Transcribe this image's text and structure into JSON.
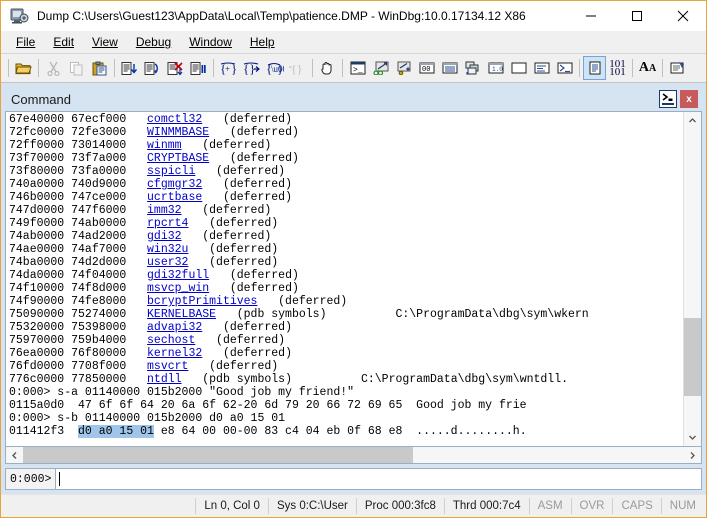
{
  "window": {
    "title": "Dump C:\\Users\\Guest123\\AppData\\Local\\Temp\\patience.DMP - WinDbg:10.0.17134.12 X86",
    "icon": "debugger-icon",
    "minimize_label": "–",
    "maximize_label": "☐",
    "close_label": "✕"
  },
  "menubar": {
    "items": [
      {
        "label": "File",
        "accel": "F"
      },
      {
        "label": "Edit",
        "accel": "E"
      },
      {
        "label": "View",
        "accel": "V"
      },
      {
        "label": "Debug",
        "accel": "D"
      },
      {
        "label": "Window",
        "accel": "W"
      },
      {
        "label": "Help",
        "accel": "H"
      }
    ]
  },
  "toolbar": {
    "groups": [
      {
        "buttons": [
          {
            "name": "open-folder-icon",
            "glyph": "📂",
            "disabled": false
          }
        ]
      },
      {
        "buttons": [
          {
            "name": "cut-icon",
            "glyph": "✂",
            "disabled": true
          },
          {
            "name": "copy-icon",
            "glyph": "⧉",
            "disabled": true
          },
          {
            "name": "paste-icon",
            "glyph": "📋",
            "disabled": false
          }
        ]
      },
      {
        "buttons": [
          {
            "name": "step-into-icon",
            "glyph": "↓",
            "disabled": false
          },
          {
            "name": "step-over-icon",
            "glyph": "↷",
            "disabled": false
          },
          {
            "name": "run-to-cursor-icon",
            "glyph": "✘",
            "disabled": false
          },
          {
            "name": "break-icon",
            "glyph": "‖",
            "disabled": false
          }
        ]
      },
      {
        "buttons": [
          {
            "name": "trace-into-icon",
            "glyph": "{+}",
            "disabled": false
          },
          {
            "name": "step-out-icon",
            "glyph": "{}→",
            "disabled": false
          },
          {
            "name": "step-branch-icon",
            "glyph": "{?}",
            "disabled": false
          },
          {
            "name": "trace-disabled-icon",
            "glyph": "{}",
            "disabled": true
          }
        ]
      },
      {
        "buttons": [
          {
            "name": "stop-debugging-hand-icon",
            "glyph": "✋",
            "disabled": false
          }
        ]
      },
      {
        "buttons": [
          {
            "name": "command-window-icon",
            "glyph": "▣",
            "disabled": false
          },
          {
            "name": "watch-window-icon",
            "glyph": "⚭",
            "disabled": false
          },
          {
            "name": "locals-window-icon",
            "glyph": "❖",
            "disabled": false
          },
          {
            "name": "registers-window-icon",
            "glyph": "▭",
            "disabled": false
          },
          {
            "name": "memory-window-icon",
            "glyph": "☰",
            "disabled": false
          },
          {
            "name": "call-stack-window-icon",
            "glyph": "❑",
            "disabled": false
          },
          {
            "name": "disassembly-window-icon",
            "glyph": "▤",
            "disabled": false
          },
          {
            "name": "scratch-pad-window-icon",
            "glyph": "▯",
            "disabled": false
          },
          {
            "name": "processes-threads-window-icon",
            "glyph": "≡",
            "disabled": false
          },
          {
            "name": "command-browser-window-icon",
            "glyph": "⮞",
            "disabled": false
          }
        ]
      },
      {
        "buttons": [
          {
            "name": "source-mode-icon",
            "glyph": "▤",
            "disabled": false,
            "active": true
          },
          {
            "name": "numeric-mode-icon",
            "glyph": "101",
            "glyph2": "101",
            "disabled": false
          }
        ]
      },
      {
        "buttons": [
          {
            "name": "font-icon",
            "glyph": "AA",
            "disabled": false
          }
        ]
      },
      {
        "buttons": [
          {
            "name": "options-icon",
            "glyph": "⚙",
            "disabled": false
          }
        ]
      }
    ]
  },
  "command_window": {
    "title": "Command",
    "dock_button": "dock-command-window-icon",
    "close_button_label": "x",
    "prompt": "0:000>",
    "input_value": "",
    "input_placeholder": ""
  },
  "output_lines": [
    {
      "cols": [
        {
          "t": "67e40000 67ecf000   ",
          "k": "plain"
        },
        {
          "t": "comctl32",
          "k": "module"
        },
        {
          "t": "   (deferred)",
          "k": "plain"
        }
      ]
    },
    {
      "cols": [
        {
          "t": "72fc0000 72fe3000   ",
          "k": "plain"
        },
        {
          "t": "WINMMBASE",
          "k": "module"
        },
        {
          "t": "   (deferred)",
          "k": "plain"
        }
      ]
    },
    {
      "cols": [
        {
          "t": "72ff0000 73014000   ",
          "k": "plain"
        },
        {
          "t": "winmm",
          "k": "module"
        },
        {
          "t": "   (deferred)",
          "k": "plain"
        }
      ]
    },
    {
      "cols": [
        {
          "t": "73f70000 73f7a000   ",
          "k": "plain"
        },
        {
          "t": "CRYPTBASE",
          "k": "module"
        },
        {
          "t": "   (deferred)",
          "k": "plain"
        }
      ]
    },
    {
      "cols": [
        {
          "t": "73f80000 73fa0000   ",
          "k": "plain"
        },
        {
          "t": "sspicli",
          "k": "module"
        },
        {
          "t": "   (deferred)",
          "k": "plain"
        }
      ]
    },
    {
      "cols": [
        {
          "t": "740a0000 740d9000   ",
          "k": "plain"
        },
        {
          "t": "cfgmgr32",
          "k": "module"
        },
        {
          "t": "   (deferred)",
          "k": "plain"
        }
      ]
    },
    {
      "cols": [
        {
          "t": "746b0000 747ce000   ",
          "k": "plain"
        },
        {
          "t": "ucrtbase",
          "k": "module"
        },
        {
          "t": "   (deferred)",
          "k": "plain"
        }
      ]
    },
    {
      "cols": [
        {
          "t": "747d0000 747f6000   ",
          "k": "plain"
        },
        {
          "t": "imm32",
          "k": "module"
        },
        {
          "t": "   (deferred)",
          "k": "plain"
        }
      ]
    },
    {
      "cols": [
        {
          "t": "749f0000 74ab0000   ",
          "k": "plain"
        },
        {
          "t": "rpcrt4",
          "k": "module"
        },
        {
          "t": "   (deferred)",
          "k": "plain"
        }
      ]
    },
    {
      "cols": [
        {
          "t": "74ab0000 74ad2000   ",
          "k": "plain"
        },
        {
          "t": "gdi32",
          "k": "module"
        },
        {
          "t": "   (deferred)",
          "k": "plain"
        }
      ]
    },
    {
      "cols": [
        {
          "t": "74ae0000 74af7000   ",
          "k": "plain"
        },
        {
          "t": "win32u",
          "k": "module"
        },
        {
          "t": "   (deferred)",
          "k": "plain"
        }
      ]
    },
    {
      "cols": [
        {
          "t": "74ba0000 74d2d000   ",
          "k": "plain"
        },
        {
          "t": "user32",
          "k": "module"
        },
        {
          "t": "   (deferred)",
          "k": "plain"
        }
      ]
    },
    {
      "cols": [
        {
          "t": "74da0000 74f04000   ",
          "k": "plain"
        },
        {
          "t": "gdi32full",
          "k": "module"
        },
        {
          "t": "   (deferred)",
          "k": "plain"
        }
      ]
    },
    {
      "cols": [
        {
          "t": "74f10000 74f8d000   ",
          "k": "plain"
        },
        {
          "t": "msvcp_win",
          "k": "module"
        },
        {
          "t": "   (deferred)",
          "k": "plain"
        }
      ]
    },
    {
      "cols": [
        {
          "t": "74f90000 74fe8000   ",
          "k": "plain"
        },
        {
          "t": "bcryptPrimitives",
          "k": "module"
        },
        {
          "t": "   (deferred)",
          "k": "plain"
        }
      ]
    },
    {
      "cols": [
        {
          "t": "75090000 75274000   ",
          "k": "plain"
        },
        {
          "t": "KERNELBASE",
          "k": "module"
        },
        {
          "t": "   (pdb symbols)          C:\\ProgramData\\dbg\\sym\\wkern",
          "k": "plain"
        }
      ]
    },
    {
      "cols": [
        {
          "t": "75320000 75398000   ",
          "k": "plain"
        },
        {
          "t": "advapi32",
          "k": "module"
        },
        {
          "t": "   (deferred)",
          "k": "plain"
        }
      ]
    },
    {
      "cols": [
        {
          "t": "75970000 759b4000   ",
          "k": "plain"
        },
        {
          "t": "sechost",
          "k": "module"
        },
        {
          "t": "   (deferred)",
          "k": "plain"
        }
      ]
    },
    {
      "cols": [
        {
          "t": "76ea0000 76f80000   ",
          "k": "plain"
        },
        {
          "t": "kernel32",
          "k": "module"
        },
        {
          "t": "   (deferred)",
          "k": "plain"
        }
      ]
    },
    {
      "cols": [
        {
          "t": "76fd0000 7708f000   ",
          "k": "plain"
        },
        {
          "t": "msvcrt",
          "k": "module"
        },
        {
          "t": "   (deferred)",
          "k": "plain"
        }
      ]
    },
    {
      "cols": [
        {
          "t": "776c0000 77850000   ",
          "k": "plain"
        },
        {
          "t": "ntdll",
          "k": "module"
        },
        {
          "t": "   (pdb symbols)          C:\\ProgramData\\dbg\\sym\\wntdll.",
          "k": "plain"
        }
      ]
    },
    {
      "cols": [
        {
          "t": "0:000> s-a 01140000 015b2000 \"Good job my friend!\"",
          "k": "plain"
        }
      ]
    },
    {
      "cols": [
        {
          "t": "0115a0d0  47 6f 6f 64 20 6a 6f 62-20 6d 79 20 66 72 69 65  Good job my frie",
          "k": "plain"
        }
      ]
    },
    {
      "cols": [
        {
          "t": "0:000> s-b 01140000 015b2000 d0 a0 15 01",
          "k": "plain"
        }
      ]
    },
    {
      "cols": [
        {
          "t": "011412f3  ",
          "k": "plain"
        },
        {
          "t": "d0 a0 15 01",
          "k": "highlight"
        },
        {
          "t": " e8 64 00 00-00 83 c4 04 eb 0f 68 e8  .....d........h.",
          "k": "plain"
        }
      ]
    }
  ],
  "statusbar": {
    "cells": [
      {
        "label": "Ln 0, Col 0",
        "dim": false,
        "name": "status-line-col"
      },
      {
        "label": "Sys 0:C:\\User",
        "dim": false,
        "name": "status-system"
      },
      {
        "label": "Proc 000:3fc8",
        "dim": false,
        "name": "status-process"
      },
      {
        "label": "Thrd 000:7c4",
        "dim": false,
        "name": "status-thread"
      },
      {
        "label": "ASM",
        "dim": true,
        "name": "status-asm"
      },
      {
        "label": "OVR",
        "dim": true,
        "name": "status-ovr"
      },
      {
        "label": "CAPS",
        "dim": true,
        "name": "status-caps"
      },
      {
        "label": "NUM",
        "dim": true,
        "name": "status-num"
      }
    ]
  },
  "colors": {
    "accent_border": "#e8a33d",
    "mdi_background": "#d6e3f0",
    "module_link": "#0000cc",
    "highlight": "#9fc6ea",
    "close_button": "#c75a5a",
    "toolbar_active": "#cce4f7"
  }
}
